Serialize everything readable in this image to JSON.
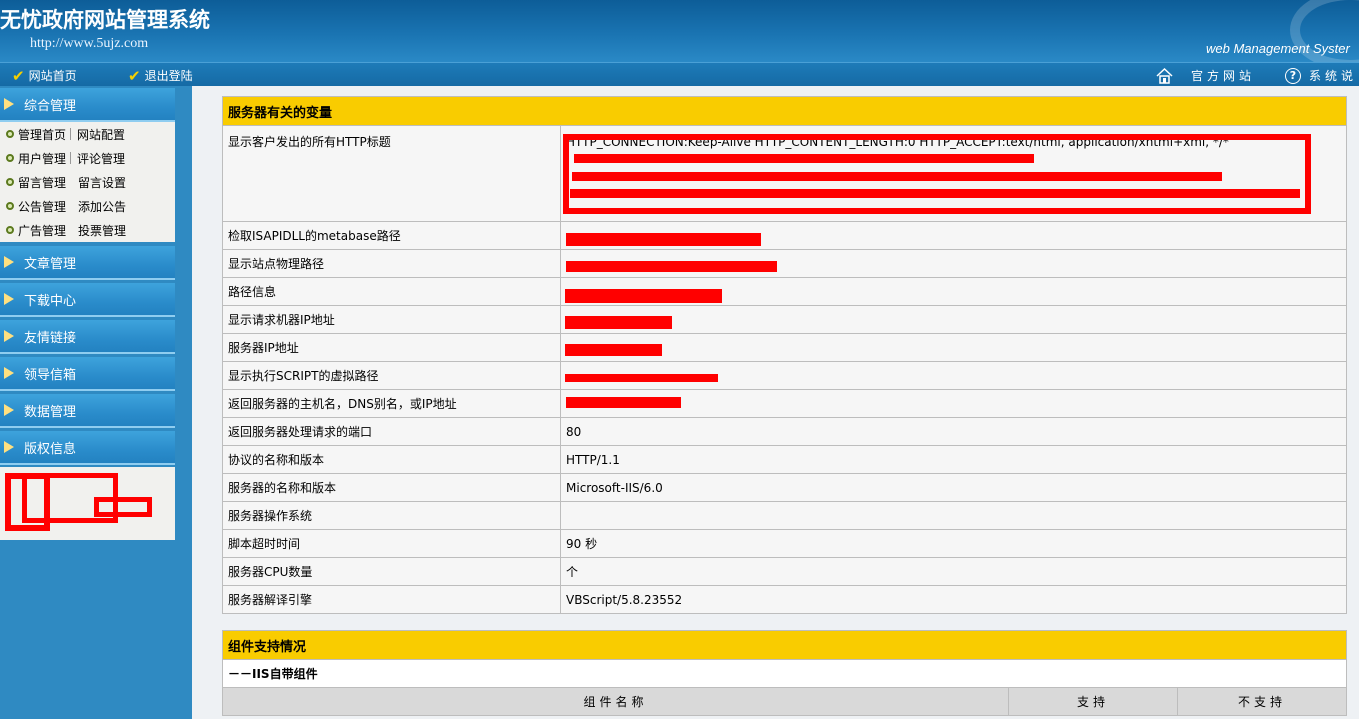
{
  "header": {
    "title": "无忧政府网站管理系统",
    "url": "http://www.5ujz.com",
    "subtitle": "web Management Syster"
  },
  "topnav": {
    "home": "网站首页",
    "logout": "退出登陆",
    "official_site": "官方网站",
    "help": "系统说"
  },
  "sidebar": {
    "sections": [
      {
        "label": "综合管理"
      },
      {
        "label": "文章管理"
      },
      {
        "label": "下载中心"
      },
      {
        "label": "友情链接"
      },
      {
        "label": "领导信箱"
      },
      {
        "label": "数据管理"
      },
      {
        "label": "版权信息"
      }
    ],
    "menu": [
      {
        "a": "管理首页",
        "b": "网站配置"
      },
      {
        "a": "用户管理",
        "b": "评论管理"
      },
      {
        "a": "留言管理",
        "b": "留言设置"
      },
      {
        "a": "公告管理",
        "b": "添加公告"
      },
      {
        "a": "广告管理",
        "b": "投票管理"
      }
    ]
  },
  "server_vars": {
    "title": "服务器有关的变量",
    "rows": [
      {
        "k": "显示客户发出的所有HTTP标题",
        "v": "HTTP_CONNECTION:Keep-Alive HTTP_CONTENT_LENGTH:0 HTTP_ACCEPT:text/html, application/xhtml+xml, */*"
      },
      {
        "k": "检取ISAPIDLL的metabase路径",
        "v": ""
      },
      {
        "k": "显示站点物理路径",
        "v": ""
      },
      {
        "k": "路径信息",
        "v": ""
      },
      {
        "k": "显示请求机器IP地址",
        "v": ""
      },
      {
        "k": "服务器IP地址",
        "v": ""
      },
      {
        "k": "显示执行SCRIPT的虚拟路径",
        "v": ""
      },
      {
        "k": "返回服务器的主机名，DNS别名，或IP地址",
        "v": ""
      },
      {
        "k": "返回服务器处理请求的端口",
        "v": "80"
      },
      {
        "k": "协议的名称和版本",
        "v": "HTTP/1.1"
      },
      {
        "k": "服务器的名称和版本",
        "v": "Microsoft-IIS/6.0"
      },
      {
        "k": "服务器操作系统",
        "v": ""
      },
      {
        "k": "脚本超时时间",
        "v": "90 秒"
      },
      {
        "k": "服务器CPU数量",
        "v": "个"
      },
      {
        "k": "服务器解译引擎",
        "v": "VBScript/5.8.23552"
      }
    ]
  },
  "components": {
    "title": "组件支持情况",
    "subtitle": "－－IIS自带组件",
    "col_name": "组件名称",
    "col_yes": "支持",
    "col_no": "不支持"
  }
}
